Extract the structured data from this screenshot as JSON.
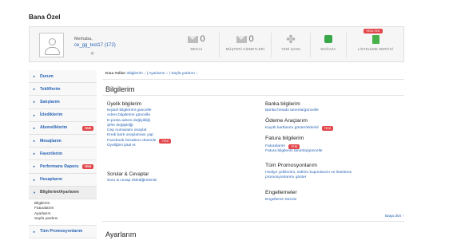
{
  "page_title": "Bana Özel",
  "profile": {
    "greeting": "Merhaba,",
    "username": "ce_gg_test17 (172)",
    "rank_icon": "star-icon"
  },
  "stats": [
    {
      "name": "mesaj",
      "count": "0",
      "label": "MESAJ",
      "icon": "envelope-icon"
    },
    {
      "name": "musteri",
      "count": "0",
      "label": "MÜŞTERİ HİZMETLERİ",
      "icon": "envelope-icon"
    },
    {
      "name": "sans",
      "count": "",
      "label": "YENİ ŞANS",
      "icon": "clover-icon"
    },
    {
      "name": "magaza",
      "count": "",
      "label": "MAĞAZA",
      "icon": "store-icon"
    },
    {
      "name": "listeleme",
      "count": "",
      "label": "LİSTELEME SERVİSİ",
      "icon": "document-icon",
      "badge": "YENİ-TEK"
    }
  ],
  "sidebar": {
    "items": [
      {
        "label": "Durum"
      },
      {
        "label": "Tekliflerim"
      },
      {
        "label": "Satışlarım"
      },
      {
        "label": "İzlediklerim"
      },
      {
        "label": "Aboneliklerim",
        "badge": "YENİ"
      },
      {
        "label": "Mesajlarım"
      },
      {
        "label": "Favorilerim"
      },
      {
        "label": "Performans Raporu",
        "badge": "YENİ"
      },
      {
        "label": "Hesaplarım"
      },
      {
        "label": "Bilgilerim/Ayarlarım"
      },
      {
        "label": "Tüm Promosyonlarım"
      }
    ],
    "subitems": [
      "Bilgilerim",
      "Faturalarım",
      "Ayarlarım",
      "Sayfa yardımı"
    ]
  },
  "breadcrumb": {
    "prefix": "Kısa Yollar:",
    "path": "Bilgilerim ↓ | Ayarlarım ↓ | Sayfa yardımı ↓"
  },
  "main": {
    "title": "Bilgilerim",
    "groups": {
      "uyelik": {
        "title": "Üyelik bilgilerim",
        "links": [
          {
            "text": "Kişisel bilgilerimi güncelle"
          },
          {
            "text": "Adres bilgilerimi güncelle"
          },
          {
            "text": "E-posta adresi değişikliği"
          },
          {
            "text": "Şifre değişikliği"
          },
          {
            "text": "Cep numaramı onaylat"
          },
          {
            "text": "Kredi kartı onaylaması yap"
          },
          {
            "text": "Facebook hesabımı düzenle",
            "badge": "YENİ"
          },
          {
            "text": "Üyeliğimi iptal et"
          }
        ]
      },
      "soru": {
        "title": "Sorular & Cevaplar",
        "links": [
          {
            "text": "Soru & cevap eklediğimlerde"
          }
        ]
      },
      "banka": {
        "title": "Banka bilgilerim",
        "links": [
          {
            "text": "Banka hesabı tanımla/güncelle"
          }
        ]
      },
      "odeme": {
        "title": "Ödeme Araçlarım",
        "links": [
          {
            "text": "Kayıtlı kartlarımı göster/ekle/sil",
            "badge": "YENİ"
          }
        ]
      },
      "fatura": {
        "title": "Fatura bilgilerim",
        "links": [
          {
            "text": "Faturalarım",
            "badge": "YENİ"
          },
          {
            "text": "Fatura bilgilerini tanımla/güncelle"
          }
        ]
      },
      "promosyon": {
        "title": "Tüm Promosyonlarım",
        "links": [
          {
            "text": "Hediye çekilerimi, indirim kuponlarımı ve listeleme"
          },
          {
            "text": "promosyonlarımı göster"
          }
        ]
      },
      "engel": {
        "title": "Engellemeler",
        "links": [
          {
            "text": "Engelleme Servisi"
          }
        ]
      }
    },
    "back_to_top": "Başa dön ↑",
    "next_title": "Ayarlarım"
  }
}
